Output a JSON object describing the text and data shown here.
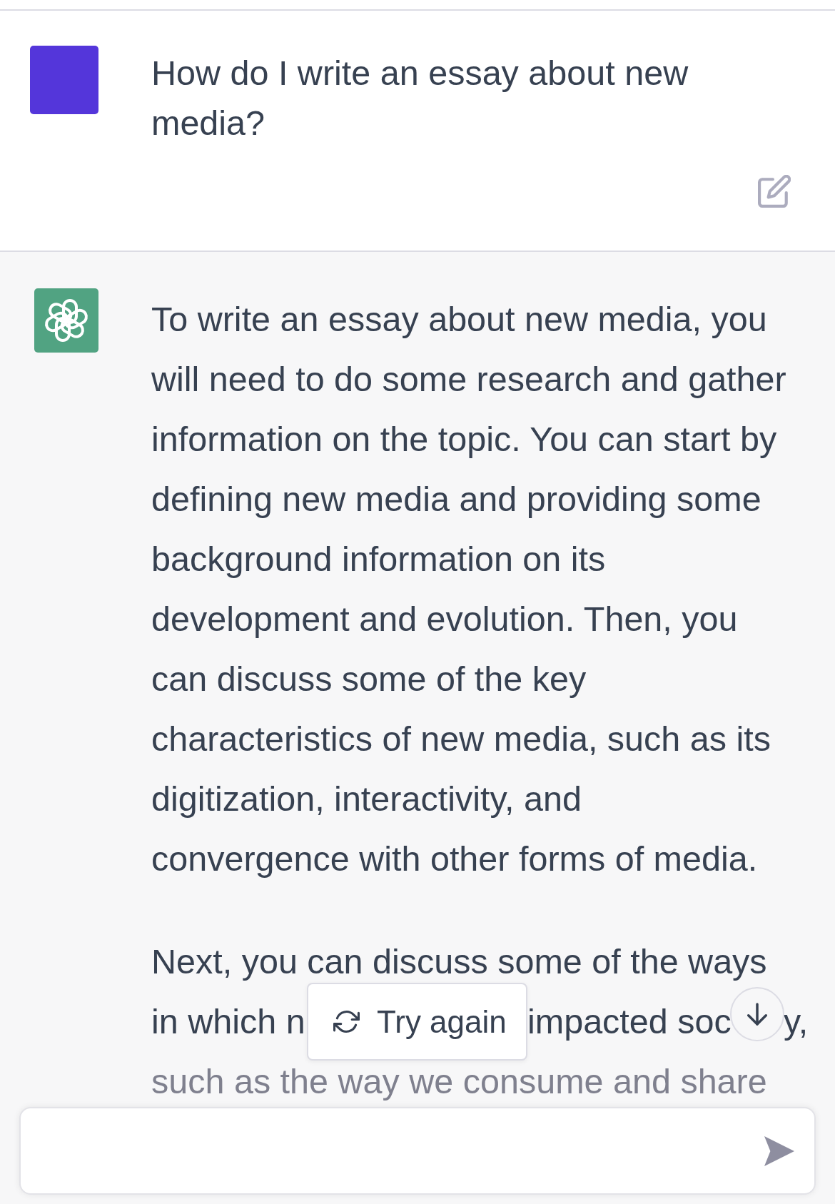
{
  "conversation": [
    {
      "kind": "user",
      "text": "How do I write an essay about new media?"
    },
    {
      "kind": "assistant",
      "paragraphs": [
        "To write an essay about new media, you will need to do some research and gather information on the topic. You can start by defining new media and providing some background information on its development and evolution. Then, you can discuss some of the key characteristics of new media, such as its digitization, interactivity, and convergence with other forms of media."
      ],
      "partly_hidden_lines": [
        [
          "Next, you can discuss some of the ways"
        ],
        [
          "in which n",
          "impacted soc",
          "y,"
        ],
        [
          "such as the way we consume and share"
        ]
      ]
    }
  ],
  "try_again_button": {
    "label": "Try again"
  }
}
